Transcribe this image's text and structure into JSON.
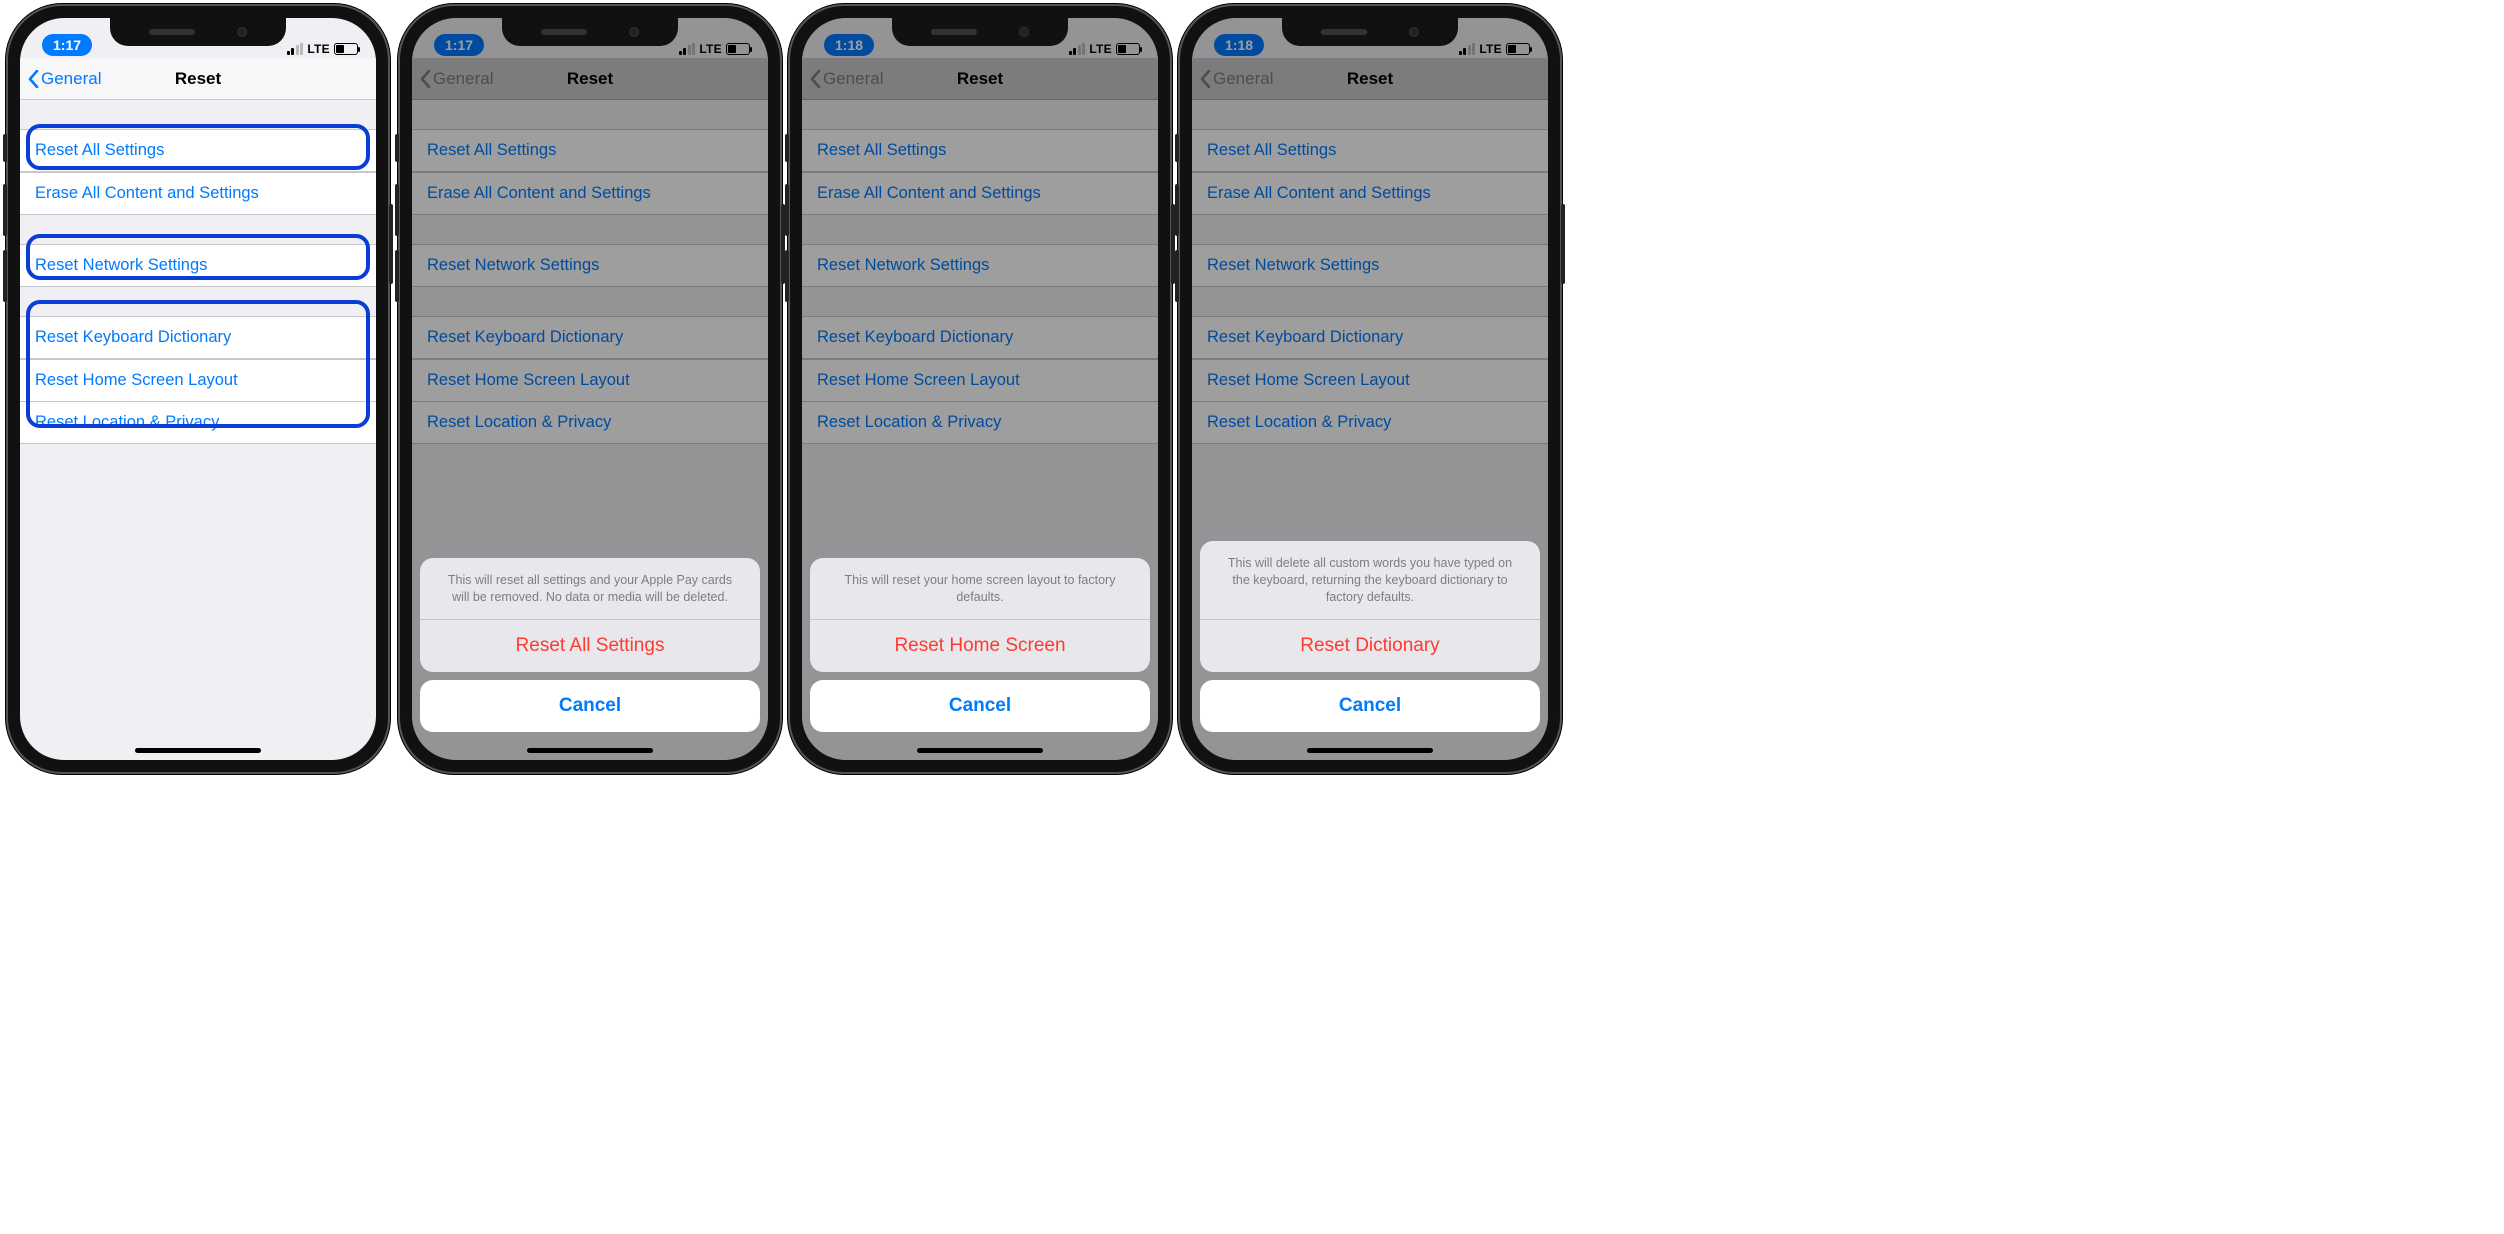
{
  "screens": [
    {
      "time": "1:17",
      "network_label": "LTE",
      "back_label": "General",
      "title": "Reset",
      "dimmed": false,
      "highlights": [
        "row0",
        "row2",
        "row3-5"
      ],
      "sheet": null
    },
    {
      "time": "1:17",
      "network_label": "LTE",
      "back_label": "General",
      "title": "Reset",
      "dimmed": true,
      "highlights": [],
      "sheet": {
        "message": "This will reset all settings and your Apple Pay cards will be removed. No data or media will be deleted.",
        "action": "Reset All Settings",
        "cancel": "Cancel"
      }
    },
    {
      "time": "1:18",
      "network_label": "LTE",
      "back_label": "General",
      "title": "Reset",
      "dimmed": true,
      "highlights": [],
      "sheet": {
        "message": "This will reset your home screen layout to factory defaults.",
        "action": "Reset Home Screen",
        "cancel": "Cancel"
      }
    },
    {
      "time": "1:18",
      "network_label": "LTE",
      "back_label": "General",
      "title": "Reset",
      "dimmed": true,
      "highlights": [],
      "sheet": {
        "message": "This will delete all custom words you have typed on the keyboard, returning the keyboard dictionary to factory defaults.",
        "action": "Reset Dictionary",
        "cancel": "Cancel"
      }
    }
  ],
  "rows": [
    "Reset All Settings",
    "Erase All Content and Settings",
    "Reset Network Settings",
    "Reset Keyboard Dictionary",
    "Reset Home Screen Layout",
    "Reset Location & Privacy"
  ]
}
